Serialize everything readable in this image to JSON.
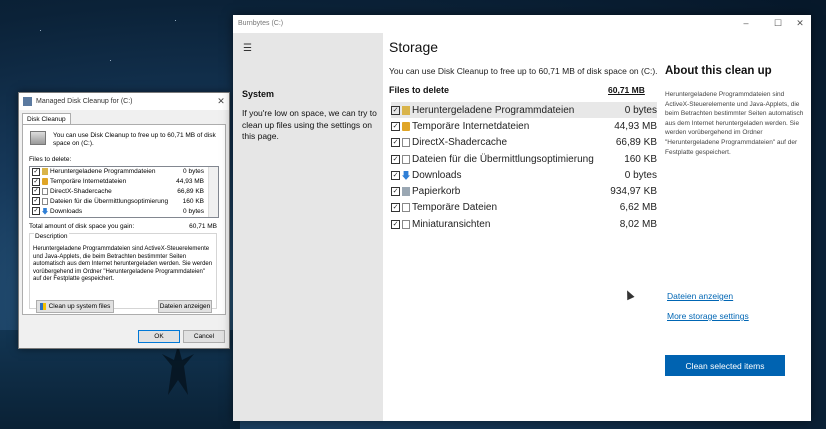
{
  "dialog": {
    "title": "Managed Disk Cleanup for  (C:)",
    "close": "✕",
    "tab": "Disk Cleanup",
    "intro": "You can use Disk Cleanup to free up to 60,71 MB of disk space on  (C:).",
    "files_label": "Files to delete:",
    "check": "✓",
    "items": [
      {
        "name": "Heruntergeladene Programmdateien",
        "size": "0 bytes",
        "icon": "folder-lock-icon"
      },
      {
        "name": "Temporäre Internetdateien",
        "size": "44,93 MB",
        "icon": "lock-icon"
      },
      {
        "name": "DirectX-Shadercache",
        "size": "66,89 KB",
        "icon": "file-icon"
      },
      {
        "name": "Dateien für die Übermittlungsoptimierung",
        "size": "160 KB",
        "icon": "file-icon"
      },
      {
        "name": "Downloads",
        "size": "0 bytes",
        "icon": "download-icon"
      }
    ],
    "total_label": "Total amount of disk space you gain:",
    "total_value": "60,71 MB",
    "desc_label": "Description",
    "desc_text": "Heruntergeladene Programmdateien sind ActiveX-Steuerelemente und Java-Applets, die beim Betrachten bestimmter Seiten automatisch aus dem Internet heruntergeladen werden. Sie werden vorübergehend im Ordner \"Heruntergeladene Programmdateien\" auf der Festplatte gespeichert.",
    "system_btn": "Clean up system files",
    "show_btn": "Dateien anzeigen",
    "ok": "OK",
    "cancel": "Cancel"
  },
  "window": {
    "title": "Burnbytes (C:)",
    "controls": [
      "–",
      "☐",
      "✕"
    ],
    "hamburger": "☰",
    "sidebar_heading": "System",
    "sidebar_text": "If you're low on space, we can try to clean up files using the settings on this page.",
    "heading": "Storage",
    "lead": "You can use Disk Cleanup to free up to 60,71 MB of disk space on  (C:).",
    "files_label": "Files to delete",
    "total": "60,71 MB",
    "check": "✓",
    "items": [
      {
        "name": "Heruntergeladene Programmdateien",
        "size": "0 bytes",
        "icon": "folder-lock-icon"
      },
      {
        "name": "Temporäre Internetdateien",
        "size": "44,93 MB",
        "icon": "lock-icon"
      },
      {
        "name": "DirectX-Shadercache",
        "size": "66,89 KB",
        "icon": "file-icon"
      },
      {
        "name": "Dateien für die Übermittlungsoptimierung",
        "size": "160 KB",
        "icon": "file-icon"
      },
      {
        "name": "Downloads",
        "size": "0 bytes",
        "icon": "download-icon"
      },
      {
        "name": "Papierkorb",
        "size": "934,97 KB",
        "icon": "recycle-bin-icon"
      },
      {
        "name": "Temporäre Dateien",
        "size": "6,62 MB",
        "icon": "file-icon"
      },
      {
        "name": "Miniaturansichten",
        "size": "8,02 MB",
        "icon": "file-icon"
      }
    ],
    "about_heading": "About this clean up",
    "about_text": "Heruntergeladene Programmdateien sind ActiveX-Steuerelemente und Java-Applets, die beim Betrachten bestimmter Seiten automatisch aus dem Internet heruntergeladen werden. Sie werden vorübergehend im Ordner \"Heruntergeladene Programmdateien\" auf der Festplatte gespeichert.",
    "link_show": "Dateien anzeigen",
    "link_more": "More storage settings",
    "cta": "Clean selected items"
  },
  "colors": {
    "accent": "#0063b1",
    "link": "#0066b4",
    "sidebar": "#e6e6e6"
  }
}
